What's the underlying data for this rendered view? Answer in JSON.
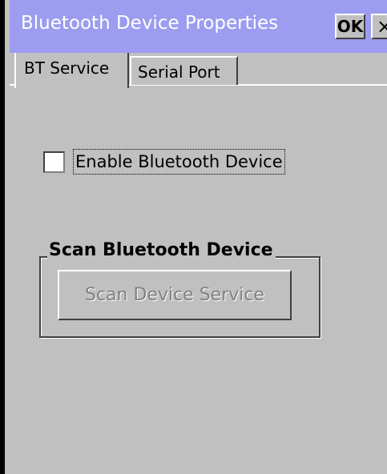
{
  "window": {
    "title": "Bluetooth Device Properties",
    "ok_label": "OK",
    "close_label": "×"
  },
  "tabs": [
    {
      "label": "BT Service",
      "selected": true
    },
    {
      "label": "Serial Port",
      "selected": false
    }
  ],
  "bt_service": {
    "enable_checkbox": {
      "label": "Enable Bluetooth Device",
      "checked": false
    },
    "scan_group": {
      "title": "Scan Bluetooth Device",
      "scan_button_label": "Scan Device Service",
      "scan_button_enabled": false
    }
  },
  "colors": {
    "titlebar": "#9c9cf0",
    "face": "#c0c0c0",
    "disabled_text": "#808080"
  }
}
